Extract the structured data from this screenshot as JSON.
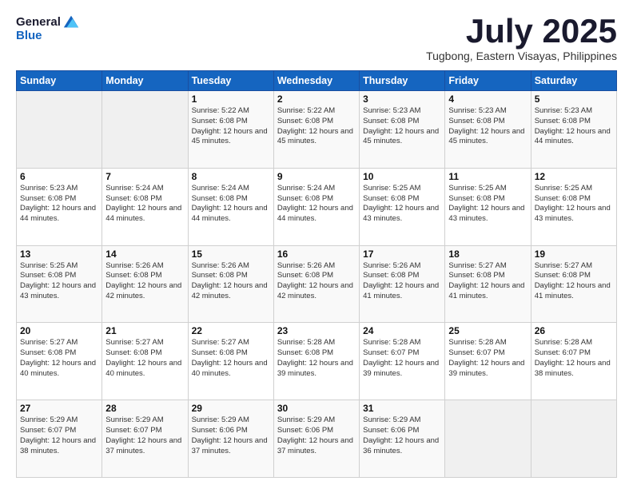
{
  "header": {
    "logo_general": "General",
    "logo_blue": "Blue",
    "month_title": "July 2025",
    "location": "Tugbong, Eastern Visayas, Philippines"
  },
  "days_of_week": [
    "Sunday",
    "Monday",
    "Tuesday",
    "Wednesday",
    "Thursday",
    "Friday",
    "Saturday"
  ],
  "weeks": [
    [
      {
        "day": "",
        "sunrise": "",
        "sunset": "",
        "daylight": ""
      },
      {
        "day": "",
        "sunrise": "",
        "sunset": "",
        "daylight": ""
      },
      {
        "day": "1",
        "sunrise": "Sunrise: 5:22 AM",
        "sunset": "Sunset: 6:08 PM",
        "daylight": "Daylight: 12 hours and 45 minutes."
      },
      {
        "day": "2",
        "sunrise": "Sunrise: 5:22 AM",
        "sunset": "Sunset: 6:08 PM",
        "daylight": "Daylight: 12 hours and 45 minutes."
      },
      {
        "day": "3",
        "sunrise": "Sunrise: 5:23 AM",
        "sunset": "Sunset: 6:08 PM",
        "daylight": "Daylight: 12 hours and 45 minutes."
      },
      {
        "day": "4",
        "sunrise": "Sunrise: 5:23 AM",
        "sunset": "Sunset: 6:08 PM",
        "daylight": "Daylight: 12 hours and 45 minutes."
      },
      {
        "day": "5",
        "sunrise": "Sunrise: 5:23 AM",
        "sunset": "Sunset: 6:08 PM",
        "daylight": "Daylight: 12 hours and 44 minutes."
      }
    ],
    [
      {
        "day": "6",
        "sunrise": "Sunrise: 5:23 AM",
        "sunset": "Sunset: 6:08 PM",
        "daylight": "Daylight: 12 hours and 44 minutes."
      },
      {
        "day": "7",
        "sunrise": "Sunrise: 5:24 AM",
        "sunset": "Sunset: 6:08 PM",
        "daylight": "Daylight: 12 hours and 44 minutes."
      },
      {
        "day": "8",
        "sunrise": "Sunrise: 5:24 AM",
        "sunset": "Sunset: 6:08 PM",
        "daylight": "Daylight: 12 hours and 44 minutes."
      },
      {
        "day": "9",
        "sunrise": "Sunrise: 5:24 AM",
        "sunset": "Sunset: 6:08 PM",
        "daylight": "Daylight: 12 hours and 44 minutes."
      },
      {
        "day": "10",
        "sunrise": "Sunrise: 5:25 AM",
        "sunset": "Sunset: 6:08 PM",
        "daylight": "Daylight: 12 hours and 43 minutes."
      },
      {
        "day": "11",
        "sunrise": "Sunrise: 5:25 AM",
        "sunset": "Sunset: 6:08 PM",
        "daylight": "Daylight: 12 hours and 43 minutes."
      },
      {
        "day": "12",
        "sunrise": "Sunrise: 5:25 AM",
        "sunset": "Sunset: 6:08 PM",
        "daylight": "Daylight: 12 hours and 43 minutes."
      }
    ],
    [
      {
        "day": "13",
        "sunrise": "Sunrise: 5:25 AM",
        "sunset": "Sunset: 6:08 PM",
        "daylight": "Daylight: 12 hours and 43 minutes."
      },
      {
        "day": "14",
        "sunrise": "Sunrise: 5:26 AM",
        "sunset": "Sunset: 6:08 PM",
        "daylight": "Daylight: 12 hours and 42 minutes."
      },
      {
        "day": "15",
        "sunrise": "Sunrise: 5:26 AM",
        "sunset": "Sunset: 6:08 PM",
        "daylight": "Daylight: 12 hours and 42 minutes."
      },
      {
        "day": "16",
        "sunrise": "Sunrise: 5:26 AM",
        "sunset": "Sunset: 6:08 PM",
        "daylight": "Daylight: 12 hours and 42 minutes."
      },
      {
        "day": "17",
        "sunrise": "Sunrise: 5:26 AM",
        "sunset": "Sunset: 6:08 PM",
        "daylight": "Daylight: 12 hours and 41 minutes."
      },
      {
        "day": "18",
        "sunrise": "Sunrise: 5:27 AM",
        "sunset": "Sunset: 6:08 PM",
        "daylight": "Daylight: 12 hours and 41 minutes."
      },
      {
        "day": "19",
        "sunrise": "Sunrise: 5:27 AM",
        "sunset": "Sunset: 6:08 PM",
        "daylight": "Daylight: 12 hours and 41 minutes."
      }
    ],
    [
      {
        "day": "20",
        "sunrise": "Sunrise: 5:27 AM",
        "sunset": "Sunset: 6:08 PM",
        "daylight": "Daylight: 12 hours and 40 minutes."
      },
      {
        "day": "21",
        "sunrise": "Sunrise: 5:27 AM",
        "sunset": "Sunset: 6:08 PM",
        "daylight": "Daylight: 12 hours and 40 minutes."
      },
      {
        "day": "22",
        "sunrise": "Sunrise: 5:27 AM",
        "sunset": "Sunset: 6:08 PM",
        "daylight": "Daylight: 12 hours and 40 minutes."
      },
      {
        "day": "23",
        "sunrise": "Sunrise: 5:28 AM",
        "sunset": "Sunset: 6:08 PM",
        "daylight": "Daylight: 12 hours and 39 minutes."
      },
      {
        "day": "24",
        "sunrise": "Sunrise: 5:28 AM",
        "sunset": "Sunset: 6:07 PM",
        "daylight": "Daylight: 12 hours and 39 minutes."
      },
      {
        "day": "25",
        "sunrise": "Sunrise: 5:28 AM",
        "sunset": "Sunset: 6:07 PM",
        "daylight": "Daylight: 12 hours and 39 minutes."
      },
      {
        "day": "26",
        "sunrise": "Sunrise: 5:28 AM",
        "sunset": "Sunset: 6:07 PM",
        "daylight": "Daylight: 12 hours and 38 minutes."
      }
    ],
    [
      {
        "day": "27",
        "sunrise": "Sunrise: 5:29 AM",
        "sunset": "Sunset: 6:07 PM",
        "daylight": "Daylight: 12 hours and 38 minutes."
      },
      {
        "day": "28",
        "sunrise": "Sunrise: 5:29 AM",
        "sunset": "Sunset: 6:07 PM",
        "daylight": "Daylight: 12 hours and 37 minutes."
      },
      {
        "day": "29",
        "sunrise": "Sunrise: 5:29 AM",
        "sunset": "Sunset: 6:06 PM",
        "daylight": "Daylight: 12 hours and 37 minutes."
      },
      {
        "day": "30",
        "sunrise": "Sunrise: 5:29 AM",
        "sunset": "Sunset: 6:06 PM",
        "daylight": "Daylight: 12 hours and 37 minutes."
      },
      {
        "day": "31",
        "sunrise": "Sunrise: 5:29 AM",
        "sunset": "Sunset: 6:06 PM",
        "daylight": "Daylight: 12 hours and 36 minutes."
      },
      {
        "day": "",
        "sunrise": "",
        "sunset": "",
        "daylight": ""
      },
      {
        "day": "",
        "sunrise": "",
        "sunset": "",
        "daylight": ""
      }
    ]
  ]
}
